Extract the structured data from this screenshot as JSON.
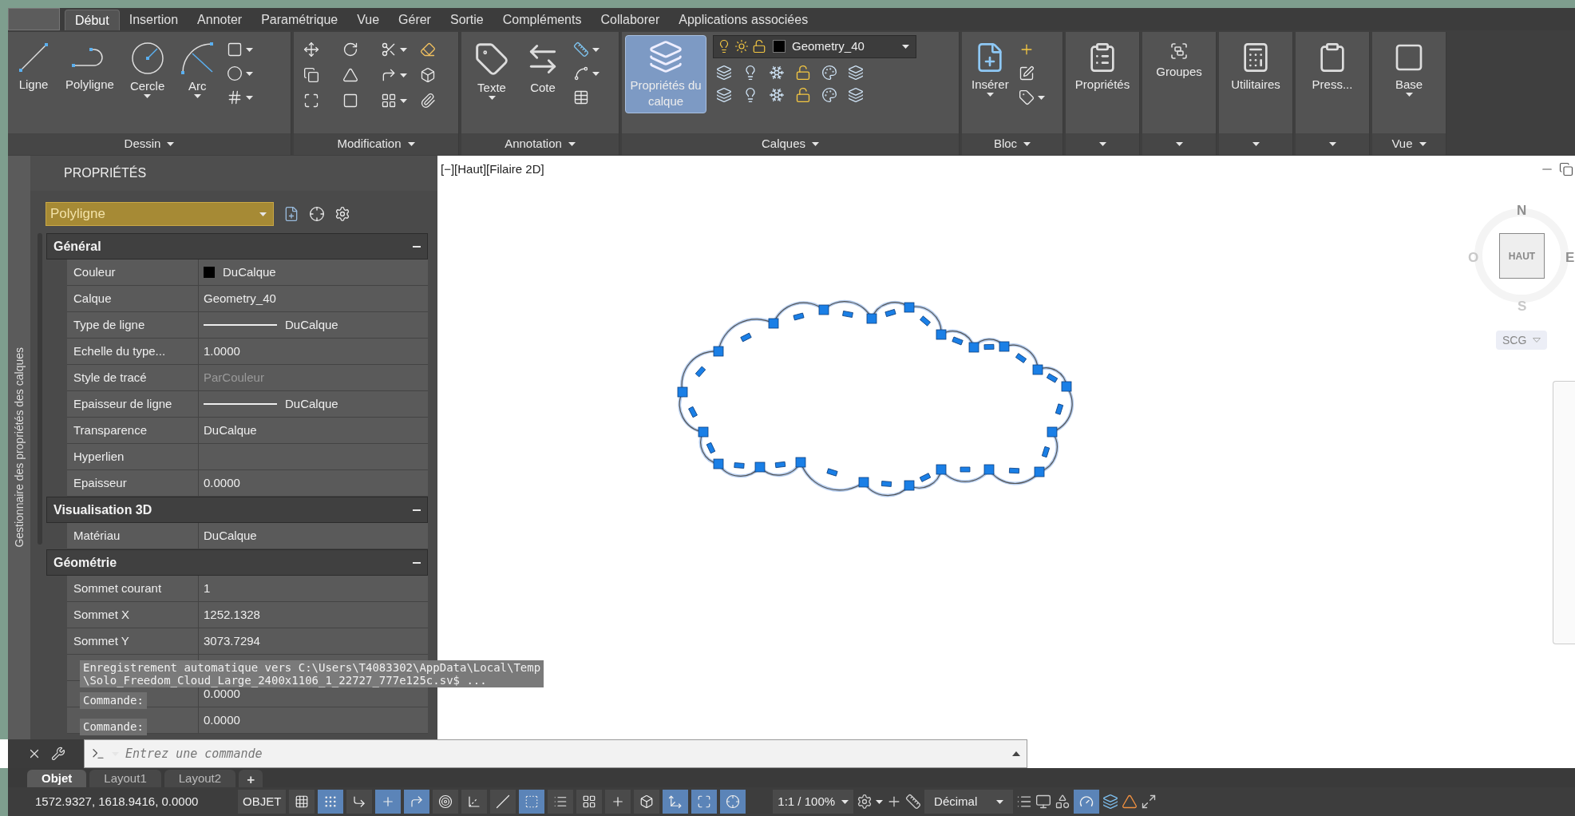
{
  "ribbon_tabs": [
    {
      "label": "Début",
      "selected": true
    },
    {
      "label": "Insertion",
      "selected": false
    },
    {
      "label": "Annoter",
      "selected": false
    },
    {
      "label": "Paramétrique",
      "selected": false
    },
    {
      "label": "Vue",
      "selected": false
    },
    {
      "label": "Gérer",
      "selected": false
    },
    {
      "label": "Sortie",
      "selected": false
    },
    {
      "label": "Compléments",
      "selected": false
    },
    {
      "label": "Collaborer",
      "selected": false
    },
    {
      "label": "Applications associées",
      "selected": false
    }
  ],
  "ribbon_panels": [
    {
      "kind": "draw",
      "title": "Dessin",
      "tools": [
        {
          "label": "Ligne",
          "active": false
        },
        {
          "label": "Polyligne",
          "active": false
        },
        {
          "label": "Cercle",
          "active": false
        },
        {
          "label": "Arc",
          "active": false
        }
      ]
    },
    {
      "kind": "modify",
      "title": "Modification"
    },
    {
      "kind": "annotate",
      "title": "Annotation",
      "tools": [
        {
          "label": "Texte",
          "active": false
        },
        {
          "label": "Cote",
          "active": false
        }
      ]
    },
    {
      "kind": "layers",
      "title": "Calques",
      "layer": "Geometry_40",
      "tools": [
        {
          "label": "Propriétés du calque",
          "active": true
        }
      ]
    },
    {
      "kind": "block",
      "title": "Bloc",
      "tools": [
        {
          "label": "Insérer",
          "active": false
        }
      ]
    },
    {
      "kind": "single",
      "tools": [
        {
          "label": "Propriétés",
          "active": false
        }
      ]
    },
    {
      "kind": "single",
      "tools": [
        {
          "label": "Groupes",
          "active": false
        }
      ]
    },
    {
      "kind": "single",
      "tools": [
        {
          "label": "Utilitaires",
          "active": false
        }
      ]
    },
    {
      "kind": "single",
      "tools": [
        {
          "label": "Press...",
          "active": false
        }
      ]
    },
    {
      "kind": "single",
      "title": "Vue",
      "tools": [
        {
          "label": "Base",
          "active": false
        }
      ]
    }
  ],
  "side_tab": "Gestionnaire des propriétés des calques",
  "properties": {
    "title": "PROPRIÉTÉS",
    "object_type": "Polyligne",
    "sections": [
      {
        "title": "Général",
        "expanded": true,
        "rows": [
          {
            "kind": "swatch",
            "label": "Couleur",
            "value": "DuCalque"
          },
          {
            "kind": "text",
            "label": "Calque",
            "value": "Geometry_40"
          },
          {
            "kind": "line",
            "label": "Type de ligne",
            "value": "DuCalque"
          },
          {
            "kind": "text",
            "label": "Echelle du type...",
            "value": "1.0000"
          },
          {
            "kind": "dim",
            "label": "Style de tracé",
            "value": "ParCouleur"
          },
          {
            "kind": "line",
            "label": "Epaisseur de ligne",
            "value": "DuCalque"
          },
          {
            "kind": "text",
            "label": "Transparence",
            "value": "DuCalque"
          },
          {
            "kind": "text",
            "label": "Hyperlien"
          },
          {
            "kind": "text",
            "label": "Epaisseur",
            "value": "0.0000"
          }
        ]
      },
      {
        "title": "Visualisation 3D",
        "expanded": true,
        "rows": [
          {
            "kind": "text",
            "label": "Matériau",
            "value": "DuCalque"
          }
        ]
      },
      {
        "title": "Géométrie",
        "expanded": true,
        "rows": [
          {
            "kind": "text",
            "label": "Sommet courant",
            "value": "1"
          },
          {
            "kind": "text",
            "label": "Sommet X",
            "value": "1252.1328"
          },
          {
            "kind": "text",
            "label": "Sommet Y",
            "value": "3073.7294"
          },
          {
            "kind": "covered"
          },
          {
            "kind": "text",
            "value": "0.0000"
          },
          {
            "kind": "text",
            "value": "0.0000"
          }
        ]
      }
    ]
  },
  "viewport": {
    "label": "[−][Haut][Filaire 2D]",
    "viewcube": {
      "top": "HAUT",
      "north": "N",
      "south": "S",
      "east": "E",
      "west": "O"
    },
    "ucs": "SCG"
  },
  "command_history": {
    "message": [
      "Enregistrement automatique vers C:\\Users\\T4083302\\AppData\\Local\\Temp",
      "\\Solo_Freedom_Cloud_Large_2400x1106_1_22727_777e125c.sv$ ..."
    ],
    "prompts": [
      "Commande:",
      "Commande:"
    ]
  },
  "command_line": {
    "placeholder": "Entrez une commande"
  },
  "layout_tabs": [
    {
      "label": "Objet",
      "selected": true
    },
    {
      "label": "Layout1",
      "selected": false
    },
    {
      "label": "Layout2",
      "selected": false
    }
  ],
  "add_tab": "+",
  "status_bar": {
    "coordinates": "1572.9327, 1618.9416, 0.0000",
    "space": "OBJET",
    "toggles": [
      {
        "on": false
      },
      {
        "on": true
      },
      {
        "on": false
      },
      {
        "on": true
      },
      {
        "on": true
      },
      {
        "on": false
      },
      {
        "on": false
      },
      {
        "on": false
      },
      {
        "on": true
      },
      {
        "on": false
      },
      {
        "on": false
      },
      {
        "on": false
      },
      {
        "on": false
      },
      {
        "on": true
      },
      {
        "on": true
      },
      {
        "on": true
      }
    ],
    "scale": "1:1 / 100%",
    "units": "Décimal",
    "hardware_on": true
  }
}
